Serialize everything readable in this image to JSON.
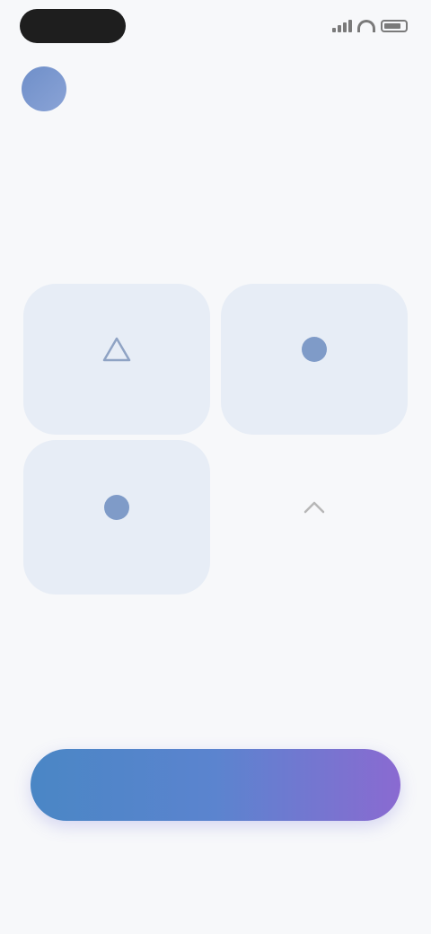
{
  "status_bar": {
    "time": "",
    "icons": [
      "signal-icon",
      "wifi-icon",
      "battery-icon"
    ]
  },
  "profile": {
    "initial": "",
    "name": ""
  },
  "headline": "",
  "subline": "",
  "cards": [
    {
      "label": "",
      "icon": "triangle-outline-icon",
      "selected": true
    },
    {
      "label": "",
      "icon": "circle-icon",
      "selected": true
    },
    {
      "label": "",
      "icon": "circle-icon",
      "selected": true
    },
    {
      "label": "",
      "icon": "chevron-up-icon",
      "selected": false
    }
  ],
  "cta_label": "",
  "footer_link": "",
  "colors": {
    "background": "#f7f8fa",
    "card_selected": "#e7edf6",
    "accent_start": "#4a86c5",
    "accent_end": "#8a6ad1"
  }
}
